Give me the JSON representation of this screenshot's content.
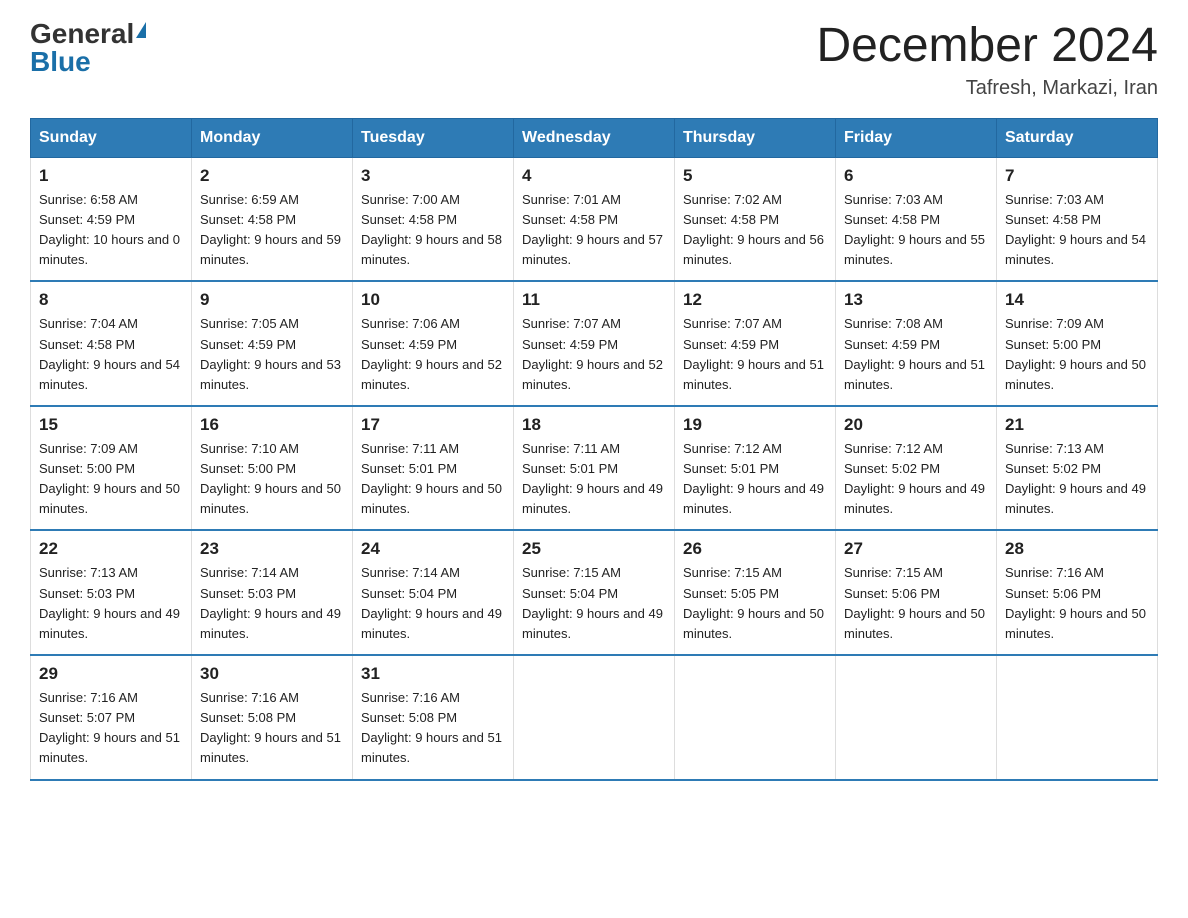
{
  "header": {
    "logo_general": "General",
    "logo_blue": "Blue",
    "month_title": "December 2024",
    "location": "Tafresh, Markazi, Iran"
  },
  "weekdays": [
    "Sunday",
    "Monday",
    "Tuesday",
    "Wednesday",
    "Thursday",
    "Friday",
    "Saturday"
  ],
  "weeks": [
    [
      {
        "day": "1",
        "sunrise": "Sunrise: 6:58 AM",
        "sunset": "Sunset: 4:59 PM",
        "daylight": "Daylight: 10 hours and 0 minutes."
      },
      {
        "day": "2",
        "sunrise": "Sunrise: 6:59 AM",
        "sunset": "Sunset: 4:58 PM",
        "daylight": "Daylight: 9 hours and 59 minutes."
      },
      {
        "day": "3",
        "sunrise": "Sunrise: 7:00 AM",
        "sunset": "Sunset: 4:58 PM",
        "daylight": "Daylight: 9 hours and 58 minutes."
      },
      {
        "day": "4",
        "sunrise": "Sunrise: 7:01 AM",
        "sunset": "Sunset: 4:58 PM",
        "daylight": "Daylight: 9 hours and 57 minutes."
      },
      {
        "day": "5",
        "sunrise": "Sunrise: 7:02 AM",
        "sunset": "Sunset: 4:58 PM",
        "daylight": "Daylight: 9 hours and 56 minutes."
      },
      {
        "day": "6",
        "sunrise": "Sunrise: 7:03 AM",
        "sunset": "Sunset: 4:58 PM",
        "daylight": "Daylight: 9 hours and 55 minutes."
      },
      {
        "day": "7",
        "sunrise": "Sunrise: 7:03 AM",
        "sunset": "Sunset: 4:58 PM",
        "daylight": "Daylight: 9 hours and 54 minutes."
      }
    ],
    [
      {
        "day": "8",
        "sunrise": "Sunrise: 7:04 AM",
        "sunset": "Sunset: 4:58 PM",
        "daylight": "Daylight: 9 hours and 54 minutes."
      },
      {
        "day": "9",
        "sunrise": "Sunrise: 7:05 AM",
        "sunset": "Sunset: 4:59 PM",
        "daylight": "Daylight: 9 hours and 53 minutes."
      },
      {
        "day": "10",
        "sunrise": "Sunrise: 7:06 AM",
        "sunset": "Sunset: 4:59 PM",
        "daylight": "Daylight: 9 hours and 52 minutes."
      },
      {
        "day": "11",
        "sunrise": "Sunrise: 7:07 AM",
        "sunset": "Sunset: 4:59 PM",
        "daylight": "Daylight: 9 hours and 52 minutes."
      },
      {
        "day": "12",
        "sunrise": "Sunrise: 7:07 AM",
        "sunset": "Sunset: 4:59 PM",
        "daylight": "Daylight: 9 hours and 51 minutes."
      },
      {
        "day": "13",
        "sunrise": "Sunrise: 7:08 AM",
        "sunset": "Sunset: 4:59 PM",
        "daylight": "Daylight: 9 hours and 51 minutes."
      },
      {
        "day": "14",
        "sunrise": "Sunrise: 7:09 AM",
        "sunset": "Sunset: 5:00 PM",
        "daylight": "Daylight: 9 hours and 50 minutes."
      }
    ],
    [
      {
        "day": "15",
        "sunrise": "Sunrise: 7:09 AM",
        "sunset": "Sunset: 5:00 PM",
        "daylight": "Daylight: 9 hours and 50 minutes."
      },
      {
        "day": "16",
        "sunrise": "Sunrise: 7:10 AM",
        "sunset": "Sunset: 5:00 PM",
        "daylight": "Daylight: 9 hours and 50 minutes."
      },
      {
        "day": "17",
        "sunrise": "Sunrise: 7:11 AM",
        "sunset": "Sunset: 5:01 PM",
        "daylight": "Daylight: 9 hours and 50 minutes."
      },
      {
        "day": "18",
        "sunrise": "Sunrise: 7:11 AM",
        "sunset": "Sunset: 5:01 PM",
        "daylight": "Daylight: 9 hours and 49 minutes."
      },
      {
        "day": "19",
        "sunrise": "Sunrise: 7:12 AM",
        "sunset": "Sunset: 5:01 PM",
        "daylight": "Daylight: 9 hours and 49 minutes."
      },
      {
        "day": "20",
        "sunrise": "Sunrise: 7:12 AM",
        "sunset": "Sunset: 5:02 PM",
        "daylight": "Daylight: 9 hours and 49 minutes."
      },
      {
        "day": "21",
        "sunrise": "Sunrise: 7:13 AM",
        "sunset": "Sunset: 5:02 PM",
        "daylight": "Daylight: 9 hours and 49 minutes."
      }
    ],
    [
      {
        "day": "22",
        "sunrise": "Sunrise: 7:13 AM",
        "sunset": "Sunset: 5:03 PM",
        "daylight": "Daylight: 9 hours and 49 minutes."
      },
      {
        "day": "23",
        "sunrise": "Sunrise: 7:14 AM",
        "sunset": "Sunset: 5:03 PM",
        "daylight": "Daylight: 9 hours and 49 minutes."
      },
      {
        "day": "24",
        "sunrise": "Sunrise: 7:14 AM",
        "sunset": "Sunset: 5:04 PM",
        "daylight": "Daylight: 9 hours and 49 minutes."
      },
      {
        "day": "25",
        "sunrise": "Sunrise: 7:15 AM",
        "sunset": "Sunset: 5:04 PM",
        "daylight": "Daylight: 9 hours and 49 minutes."
      },
      {
        "day": "26",
        "sunrise": "Sunrise: 7:15 AM",
        "sunset": "Sunset: 5:05 PM",
        "daylight": "Daylight: 9 hours and 50 minutes."
      },
      {
        "day": "27",
        "sunrise": "Sunrise: 7:15 AM",
        "sunset": "Sunset: 5:06 PM",
        "daylight": "Daylight: 9 hours and 50 minutes."
      },
      {
        "day": "28",
        "sunrise": "Sunrise: 7:16 AM",
        "sunset": "Sunset: 5:06 PM",
        "daylight": "Daylight: 9 hours and 50 minutes."
      }
    ],
    [
      {
        "day": "29",
        "sunrise": "Sunrise: 7:16 AM",
        "sunset": "Sunset: 5:07 PM",
        "daylight": "Daylight: 9 hours and 51 minutes."
      },
      {
        "day": "30",
        "sunrise": "Sunrise: 7:16 AM",
        "sunset": "Sunset: 5:08 PM",
        "daylight": "Daylight: 9 hours and 51 minutes."
      },
      {
        "day": "31",
        "sunrise": "Sunrise: 7:16 AM",
        "sunset": "Sunset: 5:08 PM",
        "daylight": "Daylight: 9 hours and 51 minutes."
      },
      null,
      null,
      null,
      null
    ]
  ]
}
